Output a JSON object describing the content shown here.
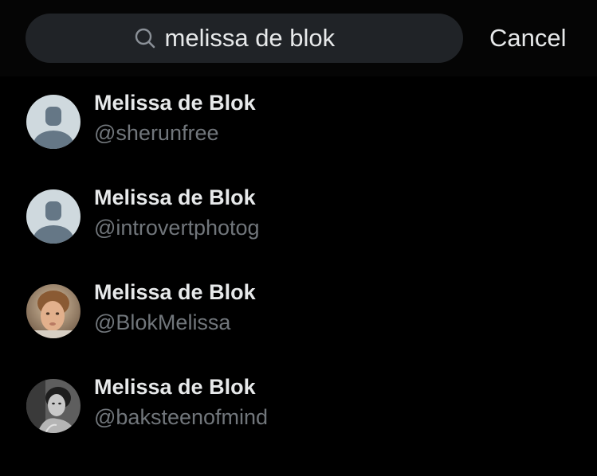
{
  "search": {
    "query": "melissa de blok",
    "cancel_label": "Cancel",
    "icon": "search-icon"
  },
  "results": [
    {
      "name": "Melissa de Blok",
      "handle": "@sherunfree",
      "avatar": "default-avatar"
    },
    {
      "name": "Melissa de Blok",
      "handle": "@introvertphotog",
      "avatar": "default-avatar"
    },
    {
      "name": "Melissa de Blok",
      "handle": "@BlokMelissa",
      "avatar": "photo-avatar"
    },
    {
      "name": "Melissa de Blok",
      "handle": "@baksteenofmind",
      "avatar": "photo-avatar-bw"
    }
  ],
  "colors": {
    "background": "#000000",
    "search_field": "#202327",
    "primary_text": "#e7e9ea",
    "secondary_text": "#71767b",
    "default_avatar_bg": "#cfd9de",
    "default_avatar_figure": "#657786"
  }
}
